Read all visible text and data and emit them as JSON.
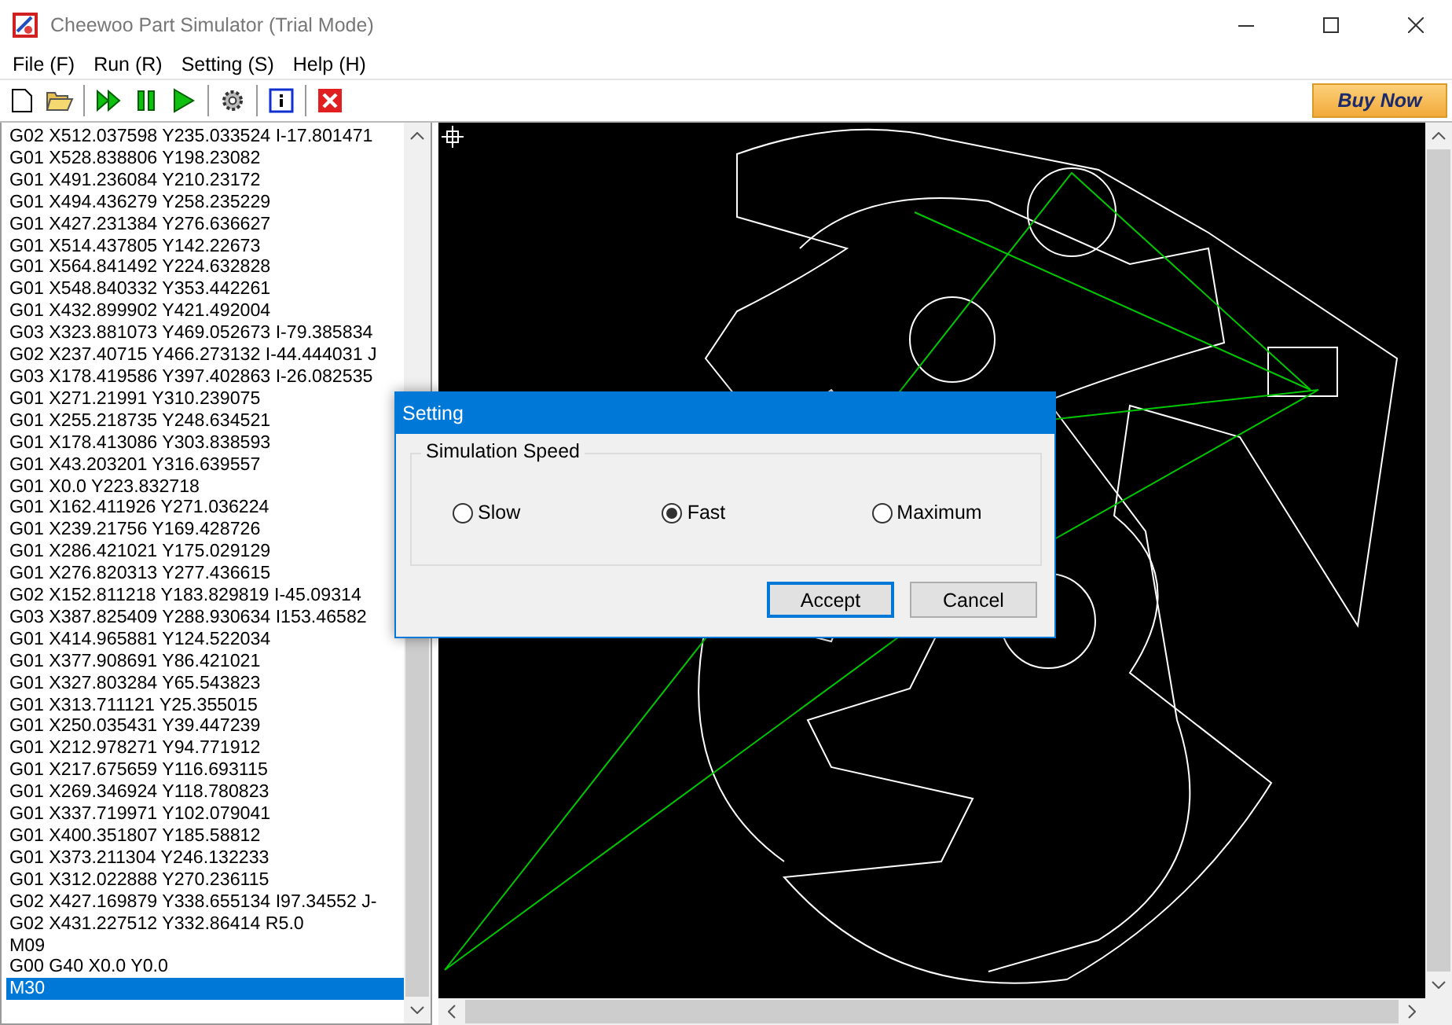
{
  "window": {
    "title": "Cheewoo Part Simulator (Trial Mode)"
  },
  "menu": [
    "File (F)",
    "Run (R)",
    "Setting (S)",
    "Help (H)"
  ],
  "toolbar": {
    "buy_button": "Buy Now"
  },
  "code_list": [
    {
      "text": "G02 X512.037598 Y235.033524 I-17.801471",
      "selected": false
    },
    {
      "text": "G01 X528.838806 Y198.23082",
      "selected": false
    },
    {
      "text": "G01 X491.236084 Y210.23172",
      "selected": false
    },
    {
      "text": "G01 X494.436279 Y258.235229",
      "selected": false
    },
    {
      "text": "G01 X427.231384 Y276.636627",
      "selected": false
    },
    {
      "text": "G01 X514.437805 Y142.22673",
      "selected": false
    },
    {
      "text": "G01 X564.841492 Y224.632828",
      "selected": false
    },
    {
      "text": "G01 X548.840332 Y353.442261",
      "selected": false
    },
    {
      "text": "G01 X432.899902 Y421.492004",
      "selected": false
    },
    {
      "text": "G03 X323.881073 Y469.052673 I-79.385834",
      "selected": false
    },
    {
      "text": "G02 X237.40715 Y466.273132 I-44.444031 J",
      "selected": false
    },
    {
      "text": "G03 X178.419586 Y397.402863 I-26.082535",
      "selected": false
    },
    {
      "text": "G01 X271.21991 Y310.239075",
      "selected": false
    },
    {
      "text": "G01 X255.218735 Y248.634521",
      "selected": false
    },
    {
      "text": "G01 X178.413086 Y303.838593",
      "selected": false
    },
    {
      "text": "G01 X43.203201 Y316.639557",
      "selected": false
    },
    {
      "text": "G01 X0.0 Y223.832718",
      "selected": false
    },
    {
      "text": "G01 X162.411926 Y271.036224",
      "selected": false
    },
    {
      "text": "G01 X239.21756 Y169.428726",
      "selected": false
    },
    {
      "text": "G01 X286.421021 Y175.029129",
      "selected": false
    },
    {
      "text": "G01 X276.820313 Y277.436615",
      "selected": false
    },
    {
      "text": "G02 X152.811218 Y183.829819 I-45.09314",
      "selected": false
    },
    {
      "text": "G03 X387.825409 Y288.930634 I153.46582",
      "selected": false
    },
    {
      "text": "G01 X414.965881 Y124.522034",
      "selected": false
    },
    {
      "text": "G01 X377.908691 Y86.421021",
      "selected": false
    },
    {
      "text": "G01 X327.803284 Y65.543823",
      "selected": false
    },
    {
      "text": "G01 X313.711121 Y25.355015",
      "selected": false
    },
    {
      "text": "G01 X250.035431 Y39.447239",
      "selected": false
    },
    {
      "text": "G01 X212.978271 Y94.771912",
      "selected": false
    },
    {
      "text": "G01 X217.675659 Y116.693115",
      "selected": false
    },
    {
      "text": "G01 X269.346924 Y118.780823",
      "selected": false
    },
    {
      "text": "G01 X337.719971 Y102.079041",
      "selected": false
    },
    {
      "text": "G01 X400.351807 Y185.58812",
      "selected": false
    },
    {
      "text": "G01 X373.211304 Y246.132233",
      "selected": false
    },
    {
      "text": "G01 X312.022888 Y270.236115",
      "selected": false
    },
    {
      "text": "G02 X427.169879 Y338.655134 I97.34552 J-",
      "selected": false
    },
    {
      "text": "G02 X431.227512 Y332.86414 R5.0",
      "selected": false
    },
    {
      "text": "M09",
      "selected": false
    },
    {
      "text": "G00 G40 X0.0 Y0.0",
      "selected": false
    },
    {
      "text": "M30",
      "selected": true
    }
  ],
  "dialog": {
    "title": "Setting",
    "group": "Simulation Speed",
    "options": [
      {
        "label": "Slow",
        "selected": false
      },
      {
        "label": "Fast",
        "selected": true
      },
      {
        "label": "Maximum",
        "selected": false
      }
    ],
    "buttons": [
      {
        "label": "Accept",
        "kind": "default"
      },
      {
        "label": "Cancel",
        "kind": "normal"
      }
    ]
  }
}
